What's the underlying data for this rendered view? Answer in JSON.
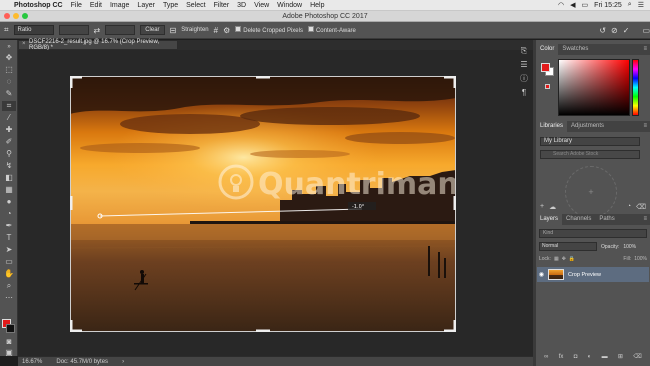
{
  "menubar": {
    "app_name": "Photoshop CC",
    "items": [
      "File",
      "Edit",
      "Image",
      "Layer",
      "Type",
      "Select",
      "Filter",
      "3D",
      "View",
      "Window",
      "Help"
    ],
    "clock": "Fri 15:25"
  },
  "window": {
    "title": "Adobe Photoshop CC 2017"
  },
  "options": {
    "ratio_select": "Ratio",
    "clear_label": "Clear",
    "straighten_label": "Straighten",
    "delete_cropped_label": "Delete Cropped Pixels",
    "content_aware_label": "Content-Aware"
  },
  "document": {
    "tab_title": "DSCF2216-2_result.jpg @ 16.7% (Crop Preview, RGB/8) *",
    "angle_readout": "-1.0°",
    "watermark": "Quantrimang"
  },
  "status": {
    "zoom": "16.67%",
    "doc_info": "Doc: 45.7M/0 bytes"
  },
  "panels": {
    "color_tab": "Color",
    "swatches_tab": "Swatches",
    "libraries_tab": "Libraries",
    "adjustments_tab": "Adjustments",
    "library_select": "My Library",
    "library_search_placeholder": "Search Adobe Stock",
    "layers_tab": "Layers",
    "channels_tab": "Channels",
    "paths_tab": "Paths",
    "kind_placeholder": "Kind",
    "blend_mode": "Normal",
    "opacity_label": "Opacity:",
    "opacity_value": "100%",
    "lock_label": "Lock:",
    "fill_label": "Fill:",
    "fill_value": "100%",
    "layer_name": "Crop Preview"
  },
  "colors": {
    "foreground": "#e21a1a",
    "background": "#ffffff",
    "accent": "#5d6c80"
  }
}
